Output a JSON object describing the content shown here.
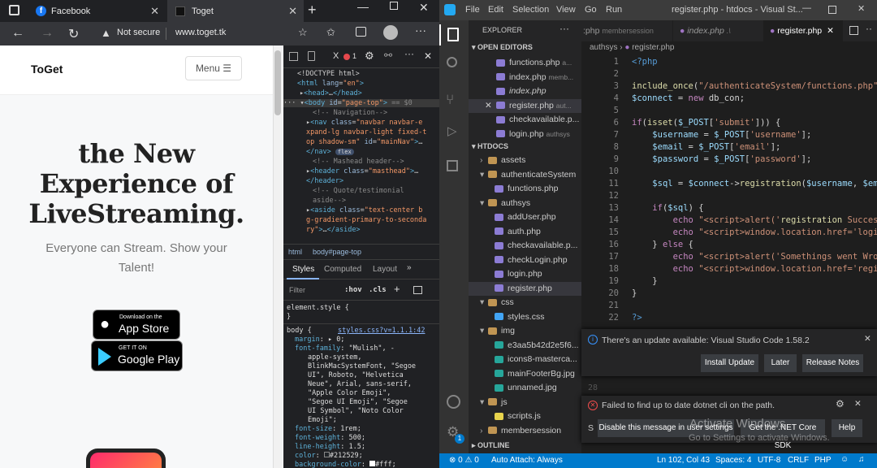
{
  "browser": {
    "tabs": [
      {
        "label": "Facebook",
        "icon": "facebook-icon"
      },
      {
        "label": "Toget",
        "icon": "page-icon"
      }
    ],
    "security": "Not secure",
    "url": "www.toget.tk"
  },
  "site": {
    "brand": "ToGet",
    "menu_label": "Menu ☰",
    "headline": [
      "the New",
      "Experience of",
      "LiveStreaming."
    ],
    "subtitle": [
      "Everyone can Stream. Show your",
      "Talent!"
    ],
    "appstore": {
      "small": "Download on the",
      "big": "App Store"
    },
    "googleplay": {
      "small": "GET IT ON",
      "big": "Google Play"
    }
  },
  "devtools": {
    "error_count": "1",
    "breadcrumb": [
      "html",
      "body#page-top"
    ],
    "tabs": [
      "Styles",
      "Computed",
      "Layout"
    ],
    "filter_placeholder": "Filter",
    "hov": ":hov",
    "cls": ".cls",
    "element_style": "element.style {",
    "close_brace": "}",
    "body_selector": "body {",
    "body_source": "styles.css?v=1.1.1:42",
    "flex_badge": "flex",
    "body_annotation": "== $0"
  },
  "vscode": {
    "menu": [
      "File",
      "Edit",
      "Selection",
      "View",
      "Go",
      "Run"
    ],
    "title": "register.php - htdocs - Visual St...",
    "explorer_title": "EXPLORER",
    "open_editors_title": "OPEN EDITORS",
    "open_editors": [
      {
        "name": "functions.php",
        "hint": "a..."
      },
      {
        "name": "index.php",
        "hint": "memb..."
      },
      {
        "name": "index.php",
        "hint": ""
      },
      {
        "name": "register.php",
        "hint": "aut..."
      },
      {
        "name": "checkavailable.p...",
        "hint": ""
      },
      {
        "name": "login.php",
        "hint": "authsys"
      }
    ],
    "htdocs_title": "HTDOCS",
    "tree": [
      {
        "name": "assets",
        "kind": "folder",
        "indent": 1
      },
      {
        "name": "authenticateSystem",
        "kind": "folder-open",
        "indent": 1
      },
      {
        "name": "functions.php",
        "kind": "php",
        "indent": 2
      },
      {
        "name": "authsys",
        "kind": "folder-open",
        "indent": 1
      },
      {
        "name": "addUser.php",
        "kind": "php",
        "indent": 2
      },
      {
        "name": "auth.php",
        "kind": "php",
        "indent": 2
      },
      {
        "name": "checkavailable.p...",
        "kind": "php",
        "indent": 2
      },
      {
        "name": "checkLogin.php",
        "kind": "php",
        "indent": 2
      },
      {
        "name": "login.php",
        "kind": "php",
        "indent": 2
      },
      {
        "name": "register.php",
        "kind": "php",
        "indent": 2
      },
      {
        "name": "css",
        "kind": "folder-open",
        "indent": 1
      },
      {
        "name": "styles.css",
        "kind": "css",
        "indent": 2
      },
      {
        "name": "img",
        "kind": "folder-open",
        "indent": 1
      },
      {
        "name": "e3aa5b42d2e5f6...",
        "kind": "img",
        "indent": 2
      },
      {
        "name": "icons8-masterca...",
        "kind": "img",
        "indent": 2
      },
      {
        "name": "mainFooterBg.jpg",
        "kind": "img",
        "indent": 2
      },
      {
        "name": "unnamed.jpg",
        "kind": "img",
        "indent": 2
      },
      {
        "name": "js",
        "kind": "folder-open",
        "indent": 1
      },
      {
        "name": "scripts.js",
        "kind": "js",
        "indent": 2
      },
      {
        "name": "membersession",
        "kind": "folder",
        "indent": 1
      }
    ],
    "outline_title": "OUTLINE",
    "editor_tabs": [
      {
        "label": ":php",
        "hint": "membersession"
      },
      {
        "label": "index.php",
        "hint": ".\\"
      },
      {
        "label": "register.php",
        "hint": ""
      }
    ],
    "breadcrumb": [
      "authsys",
      "register.php"
    ],
    "code": [
      {
        "n": "1",
        "t": "<?php"
      },
      {
        "n": "2",
        "t": ""
      },
      {
        "n": "3",
        "t": "include_once(\"/authenticateSystem/functions.php\");"
      },
      {
        "n": "4",
        "t": "$connect = new db_con;"
      },
      {
        "n": "5",
        "t": ""
      },
      {
        "n": "6",
        "t": "if(isset($_POST['submit'])) {"
      },
      {
        "n": "7",
        "t": "    $username = $_POST['username'];"
      },
      {
        "n": "8",
        "t": "    $email = $_POST['email'];"
      },
      {
        "n": "9",
        "t": "    $password = $_POST['password'];"
      },
      {
        "n": "10",
        "t": ""
      },
      {
        "n": "11",
        "t": "    $sql = $connect->registration($username, $email,"
      },
      {
        "n": "12",
        "t": ""
      },
      {
        "n": "13",
        "t": "    if($sql) {"
      },
      {
        "n": "14",
        "t": "        echo \"<script>alert('registration Success');"
      },
      {
        "n": "15",
        "t": "        echo \"<script>window.location.href='login.ph"
      },
      {
        "n": "16",
        "t": "    } else {"
      },
      {
        "n": "17",
        "t": "        echo \"<script>alert('Somethings went Wrong,"
      },
      {
        "n": "18",
        "t": "        echo \"<script>window.location.href='register"
      },
      {
        "n": "19",
        "t": "    }"
      },
      {
        "n": "20",
        "t": "}"
      },
      {
        "n": "21",
        "t": ""
      },
      {
        "n": "22",
        "t": "?>"
      }
    ],
    "update_notice": "There's an update available: Visual Studio Code 1.58.2",
    "update_buttons": [
      "Install Update",
      "Later",
      "Release Notes"
    ],
    "dotnet_notice": "Failed to find up to date dotnet cli on the path.",
    "dotnet_buttons": [
      "Disable this message in user settings",
      "Get the .NET Core SDK",
      "Help"
    ],
    "watermark": [
      "Activate Windows",
      "Go to Settings to activate Windows."
    ],
    "status": {
      "problems": "⊗ 0  ⚠ 0",
      "attach": "Auto Attach: Always",
      "position": "Ln 102, Col 43",
      "spaces": "Spaces: 4",
      "encoding": "UTF-8",
      "eol": "CRLF",
      "lang": "PHP"
    },
    "settings_badge": "1"
  },
  "colors": {
    "vscode_blue": "#007acc",
    "browser_dark": "#202124",
    "facebook": "#1877f2"
  }
}
